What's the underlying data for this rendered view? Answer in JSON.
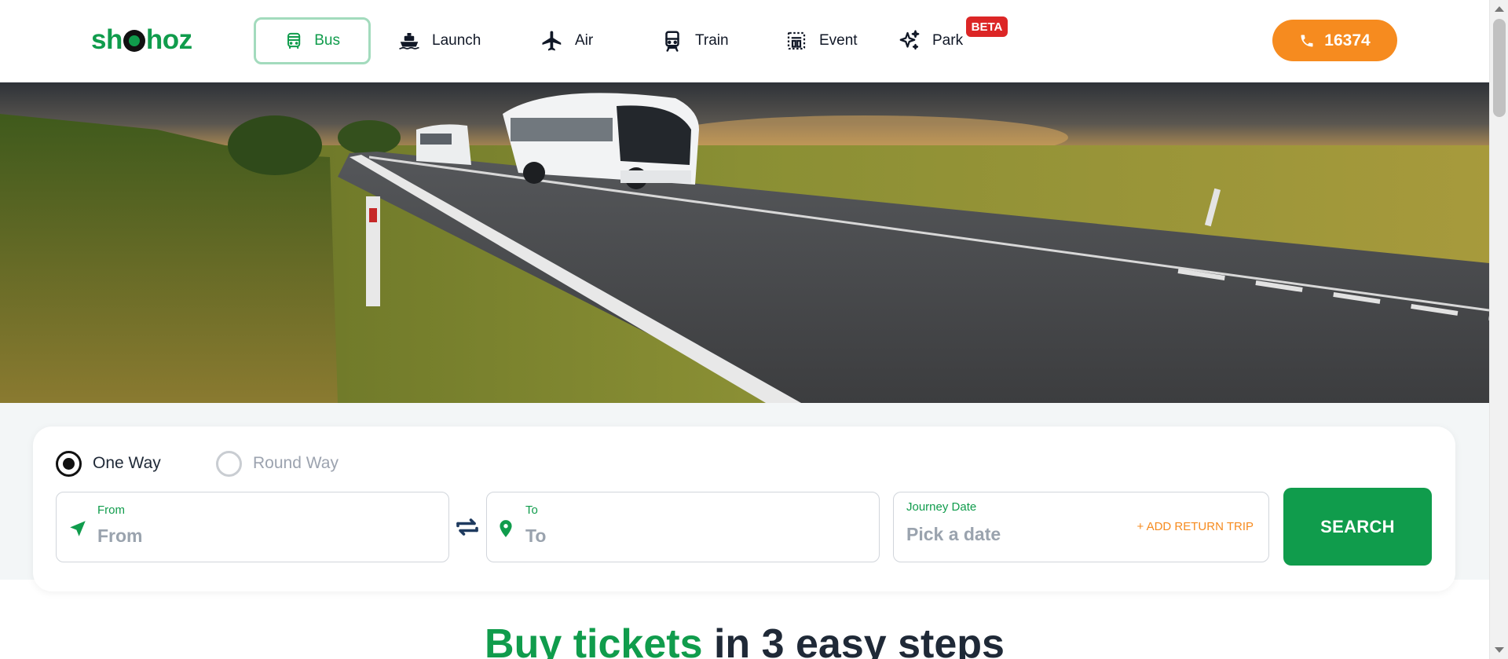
{
  "brand": {
    "logo_text_pre": "sh",
    "logo_text_post": "hoz",
    "logo_color": "#109c4c"
  },
  "nav": {
    "items": [
      {
        "label": "Bus",
        "icon": "bus-icon",
        "active": true
      },
      {
        "label": "Launch",
        "icon": "ship-icon",
        "active": false
      },
      {
        "label": "Air",
        "icon": "airplane-icon",
        "active": false
      },
      {
        "label": "Train",
        "icon": "train-icon",
        "active": false
      },
      {
        "label": "Event",
        "icon": "event-icon",
        "active": false
      },
      {
        "label": "Park",
        "icon": "sparkles-icon",
        "active": false
      }
    ],
    "park_badge": "BETA"
  },
  "hotline": {
    "number": "16374",
    "icon": "phone-icon",
    "color": "#f68b1f"
  },
  "hero": {
    "image": "bus-on-highway-photo"
  },
  "search": {
    "trip_types": [
      {
        "label": "One Way",
        "selected": true
      },
      {
        "label": "Round Way",
        "selected": false
      }
    ],
    "from": {
      "label": "From",
      "placeholder": "From",
      "icon": "navigation-arrow-icon"
    },
    "to": {
      "label": "To",
      "placeholder": "To",
      "icon": "map-pin-icon"
    },
    "swap_icon": "swap-arrows-icon",
    "journey_date": {
      "label": "Journey Date",
      "placeholder": "Pick a date"
    },
    "add_return_trip": "+ ADD RETURN TRIP",
    "search_button": "SEARCH"
  },
  "section": {
    "heading_highlight": "Buy tickets",
    "heading_rest": " in 3 easy steps"
  },
  "colors": {
    "primary_green": "#109c4c",
    "accent_orange": "#f68b1f",
    "beta_red": "#dc2626"
  }
}
